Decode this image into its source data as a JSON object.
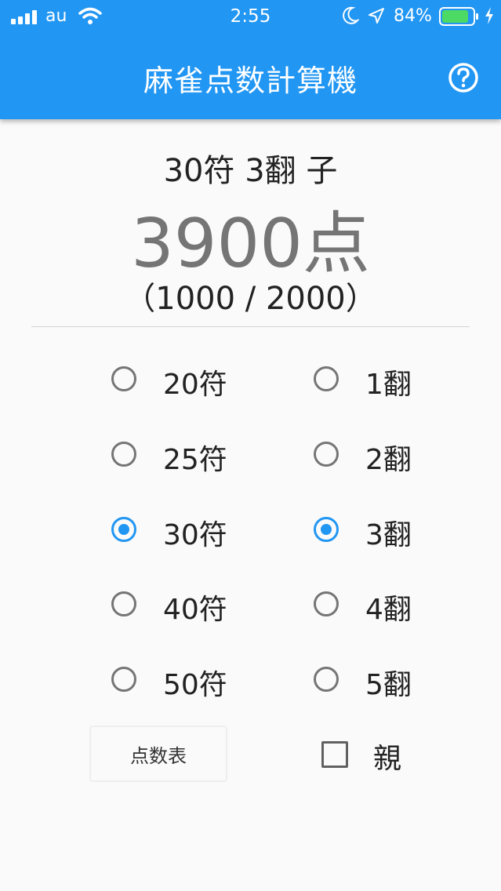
{
  "status_bar": {
    "carrier": "au",
    "time": "2:55",
    "battery": "84%"
  },
  "app_bar": {
    "title": "麻雀点数計算機",
    "help_icon": "question-circle-icon"
  },
  "result": {
    "summary": "30符 3翻 子",
    "points": "3900点",
    "split": "（1000 / 2000）"
  },
  "fu_options": [
    {
      "label": "20符",
      "selected": false
    },
    {
      "label": "25符",
      "selected": false
    },
    {
      "label": "30符",
      "selected": true
    },
    {
      "label": "40符",
      "selected": false
    },
    {
      "label": "50符",
      "selected": false
    }
  ],
  "han_options": [
    {
      "label": "1翻",
      "selected": false
    },
    {
      "label": "2翻",
      "selected": false
    },
    {
      "label": "3翻",
      "selected": true
    },
    {
      "label": "4翻",
      "selected": false
    },
    {
      "label": "5翻",
      "selected": false
    }
  ],
  "controls": {
    "score_table_label": "点数表",
    "dealer_label": "親",
    "dealer_checked": false
  },
  "colors": {
    "primary": "#2196f3",
    "unselected": "#757575"
  }
}
